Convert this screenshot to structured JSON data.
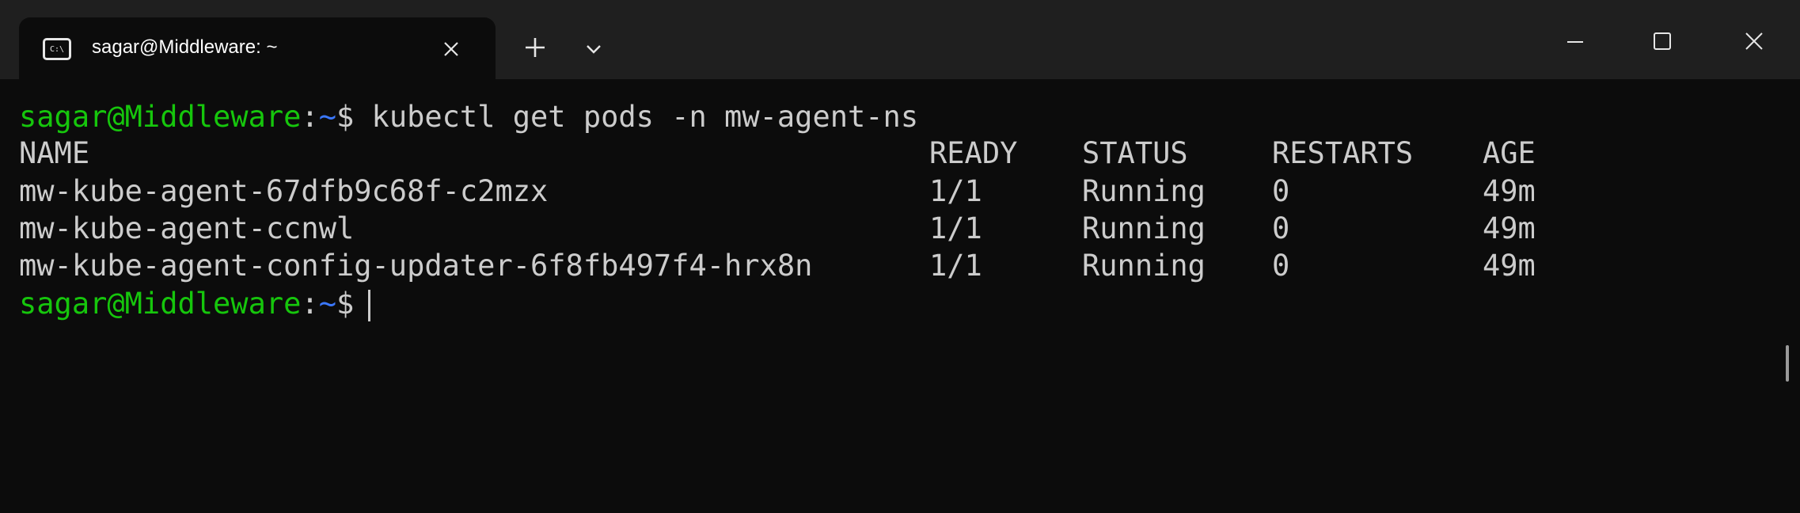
{
  "window": {
    "tab_title": "sagar@Middleware: ~",
    "tab_icon": "terminal-icon",
    "tab_icon_text": "C:\\",
    "close_tab_icon": "close-icon",
    "new_tab_icon": "plus-icon",
    "dropdown_icon": "chevron-down-icon",
    "controls": [
      "minimize-icon",
      "maximize-icon",
      "close-icon"
    ]
  },
  "terminal": {
    "prompt_user": "sagar@Middleware",
    "prompt_sep": ":",
    "prompt_path": "~",
    "prompt_symbol": "$",
    "command": " kubectl get pods -n mw-agent-ns",
    "headers": {
      "name": "NAME",
      "ready": "READY",
      "status": "STATUS",
      "restarts": "RESTARTS",
      "age": "AGE"
    },
    "rows": [
      {
        "name": "mw-kube-agent-67dfb9c68f-c2mzx",
        "ready": "1/1",
        "status": "Running",
        "restarts": "0",
        "age": "49m"
      },
      {
        "name": "mw-kube-agent-ccnwl",
        "ready": "1/1",
        "status": "Running",
        "restarts": "0",
        "age": "49m"
      },
      {
        "name": "mw-kube-agent-config-updater-6f8fb497f4-hrx8n",
        "ready": "1/1",
        "status": "Running",
        "restarts": "0",
        "age": "49m"
      }
    ]
  },
  "colors": {
    "background": "#0c0c0c",
    "titlebar": "#1f1f1f",
    "prompt_user": "#16c60c",
    "prompt_path": "#3b78ff",
    "text": "#cccccc"
  }
}
